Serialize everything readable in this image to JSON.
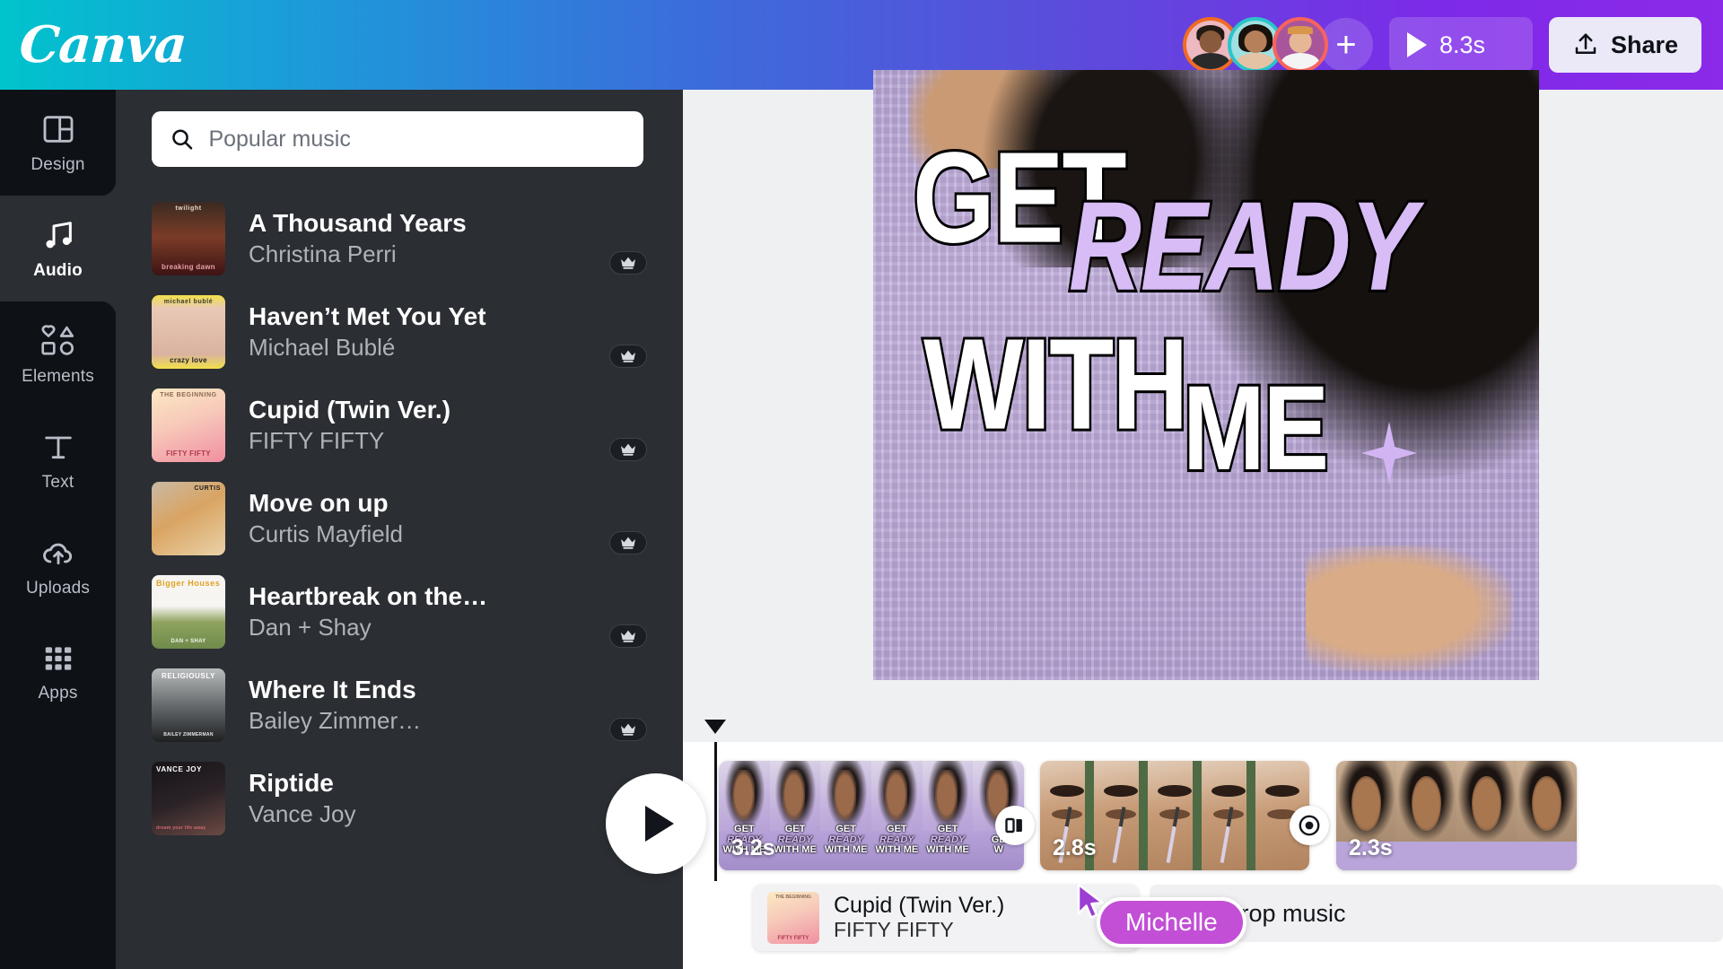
{
  "app": {
    "brand": "Canva"
  },
  "topbar": {
    "avatars": [
      {
        "name": "collaborator-1",
        "ring": "#f26b21"
      },
      {
        "name": "collaborator-2",
        "ring": "#2bc4c9"
      },
      {
        "name": "collaborator-3",
        "ring": "#f8635c"
      }
    ],
    "add_collaborator_label": "+",
    "duration_label": "8.3s",
    "share_label": "Share"
  },
  "rail": {
    "items": [
      {
        "label": "Design",
        "icon": "layout-icon",
        "active": false
      },
      {
        "label": "Audio",
        "icon": "music-note-icon",
        "active": true
      },
      {
        "label": "Elements",
        "icon": "shapes-icon",
        "active": false
      },
      {
        "label": "Text",
        "icon": "text-t-icon",
        "active": false
      },
      {
        "label": "Uploads",
        "icon": "cloud-upload-icon",
        "active": false
      },
      {
        "label": "Apps",
        "icon": "grid-dots-icon",
        "active": false
      }
    ]
  },
  "panel": {
    "search": {
      "placeholder": "Popular music",
      "value": "",
      "icon": "search-icon"
    },
    "tracks": [
      {
        "title": "A Thousand Years",
        "artist": "Christina Perri",
        "pro": true,
        "art_top": "twilight",
        "art_main": "breaking dawn"
      },
      {
        "title": "Haven’t Met You Yet",
        "artist": "Michael Bublé",
        "pro": true,
        "art_top": "michael bublé",
        "art_main": "crazy love"
      },
      {
        "title": "Cupid (Twin Ver.)",
        "artist": "FIFTY FIFTY",
        "pro": true,
        "art_top": "THE BEGINNING",
        "art_main": "FIFTY FIFTY"
      },
      {
        "title": "Move on up",
        "artist": "Curtis Mayfield",
        "pro": true,
        "art_top": "CURTIS",
        "art_main": ""
      },
      {
        "title": "Heartbreak on the…",
        "artist": "Dan + Shay",
        "pro": true,
        "art_top": "Bigger Houses",
        "art_main": "DAN + SHAY"
      },
      {
        "title": "Where It Ends",
        "artist": "Bailey Zimmer…",
        "pro": true,
        "art_top": "RELIGIOUSLY",
        "art_main": "BAILEY ZIMMERMAN"
      },
      {
        "title": "Riptide",
        "artist": "Vance Joy",
        "pro": true,
        "art_top": "VANCE JOY",
        "art_main": "dream your life away"
      }
    ],
    "pro_badge_icon": "crown-icon"
  },
  "canvas": {
    "text_lines": [
      {
        "text": "GET",
        "style": "white-outline"
      },
      {
        "text": "READY",
        "style": "lavender-italic-outline"
      },
      {
        "text": "WITH",
        "style": "white-outline"
      },
      {
        "text": "ME",
        "style": "white-outline"
      }
    ],
    "sparkle_icon": "four-point-star-icon",
    "accent_color": "#d8bcf5"
  },
  "timeline": {
    "play_button_icon": "play-icon",
    "playhead_icon": "playhead-marker-icon",
    "clips": [
      {
        "duration": "3.2s",
        "kind": "gwm-intro",
        "frames": 6,
        "caption_a": "GET",
        "caption_b": "READY",
        "caption_c": "WITH",
        "caption_d": "ME"
      },
      {
        "duration": "2.8s",
        "kind": "eye-makeup",
        "frames": 5
      },
      {
        "duration": "2.3s",
        "kind": "smile-outro",
        "frames": 4
      }
    ],
    "transitions": [
      {
        "icon": "transition-dissolve-icon",
        "glyph": "□◗"
      },
      {
        "icon": "transition-circle-wipe-icon",
        "glyph": "◎"
      }
    ],
    "audio_clip": {
      "title": "Cupid (Twin Ver.)",
      "artist": "FIFTY FIFTY",
      "art_top": "THE BEGINNING",
      "art_main": "FIFTY FIFTY"
    },
    "drop_music": {
      "label": "Drop music",
      "icon": "music-note-icon"
    },
    "collaborator_cursor": {
      "name": "Michelle",
      "color": "#c24fd6"
    }
  }
}
